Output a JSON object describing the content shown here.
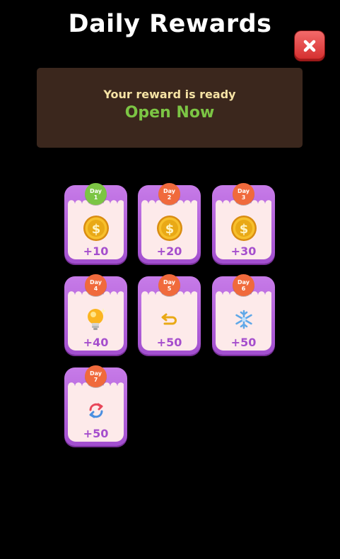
{
  "title": "Daily Rewards",
  "banner": {
    "subtitle": "Your reward is ready",
    "action": "Open Now"
  },
  "rewards": [
    {
      "day_label": "Day",
      "day_number": "1",
      "amount": "+10",
      "icon": "coin-icon",
      "state": "current"
    },
    {
      "day_label": "Day",
      "day_number": "2",
      "amount": "+20",
      "icon": "coin-icon",
      "state": "upcoming"
    },
    {
      "day_label": "Day",
      "day_number": "3",
      "amount": "+30",
      "icon": "coin-icon",
      "state": "upcoming"
    },
    {
      "day_label": "Day",
      "day_number": "4",
      "amount": "+40",
      "icon": "lightbulb-icon",
      "state": "upcoming"
    },
    {
      "day_label": "Day",
      "day_number": "5",
      "amount": "+50",
      "icon": "undo-icon",
      "state": "upcoming"
    },
    {
      "day_label": "Day",
      "day_number": "6",
      "amount": "+50",
      "icon": "snowflake-icon",
      "state": "upcoming"
    },
    {
      "day_label": "Day",
      "day_number": "7",
      "amount": "+50",
      "icon": "shuffle-icon",
      "state": "upcoming"
    }
  ],
  "colors": {
    "background": "#000000",
    "banner": "#3b271d",
    "banner_subtitle": "#f6e3a5",
    "banner_action": "#7cc544",
    "card_frame": "#b462dc",
    "card_inner": "#fdeaea",
    "amount_text": "#a54ecd",
    "badge_current": "#7cc544",
    "badge_upcoming": "#f06a3c",
    "close_button": "#e04040"
  }
}
